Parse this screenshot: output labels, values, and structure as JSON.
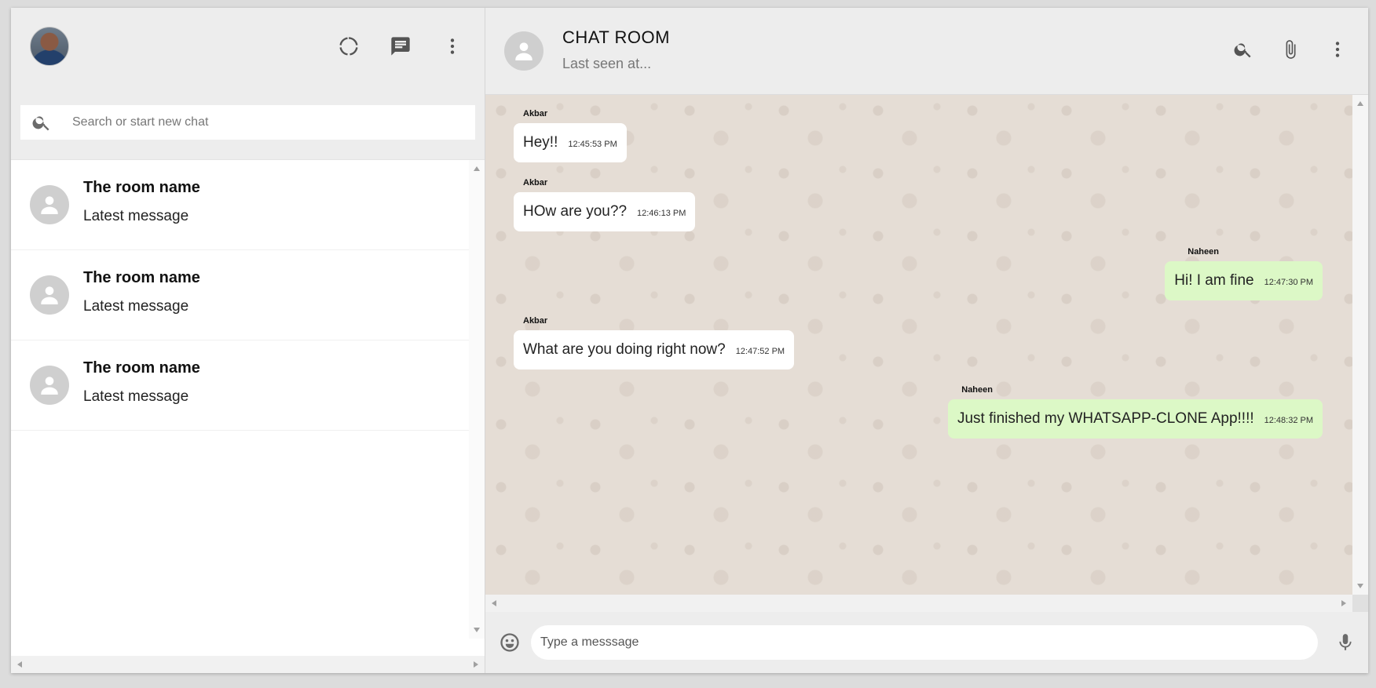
{
  "sidebar": {
    "header": {
      "avatar_icon": "user-photo",
      "icons": [
        "status-icon",
        "chat-icon",
        "more-vert-icon"
      ]
    },
    "search": {
      "placeholder": "Search or start new chat",
      "icon": "search-icon"
    },
    "rooms": [
      {
        "name": "The room name",
        "last_message": "Latest message"
      },
      {
        "name": "The room name",
        "last_message": "Latest message"
      },
      {
        "name": "The room name",
        "last_message": "Latest message"
      }
    ]
  },
  "chat": {
    "header": {
      "title": "CHAT ROOM",
      "subtitle": "Last seen at...",
      "icons": [
        "search-icon",
        "attach-icon",
        "more-vert-icon"
      ]
    },
    "messages": [
      {
        "name": "Akbar",
        "text": "Hey!!",
        "time": "12:45:53 PM",
        "sent": false
      },
      {
        "name": "Akbar",
        "text": "HOw are you??",
        "time": "12:46:13 PM",
        "sent": false
      },
      {
        "name": "Naheen",
        "text": "Hi! I am fine",
        "time": "12:47:30 PM",
        "sent": true
      },
      {
        "name": "Akbar",
        "text": "What are you doing right now?",
        "time": "12:47:52 PM",
        "sent": false
      },
      {
        "name": "Naheen",
        "text": "Just finished my WHATSAPP-CLONE App!!!!",
        "time": "12:48:32 PM",
        "sent": true
      }
    ],
    "footer": {
      "placeholder": "Type a messsage",
      "emoji_icon": "emoji-icon",
      "mic_icon": "mic-icon"
    }
  },
  "colors": {
    "sent_bubble": "#dcf8c6",
    "received_bubble": "#ffffff",
    "chat_background": "#e5ddd5",
    "panel_header": "#ededed"
  }
}
